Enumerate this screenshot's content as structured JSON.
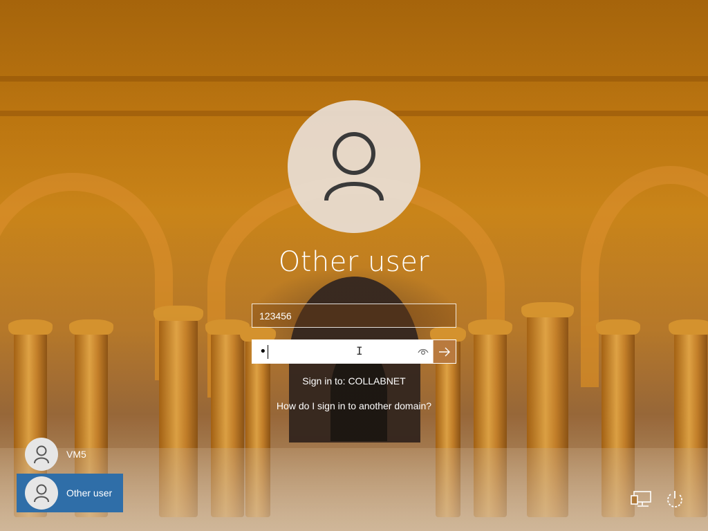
{
  "user": {
    "display_name": "Other user"
  },
  "form": {
    "username_value": "123456",
    "password_masked": "•",
    "sign_in_to": "Sign in to: COLLABNET",
    "other_domain_link": "How do I sign in to another domain?"
  },
  "user_list": [
    {
      "name": "VM5",
      "selected": false
    },
    {
      "name": "Other user",
      "selected": true
    }
  ],
  "icons": {
    "avatar": "person-icon",
    "reveal": "eye-icon",
    "submit": "arrow-right-icon",
    "network": "network-icon",
    "power": "power-icon"
  },
  "colors": {
    "selected_tile": "#2f6ea8",
    "submit_button": "#b97a3e",
    "avatar_bg": "#e8ded4"
  }
}
